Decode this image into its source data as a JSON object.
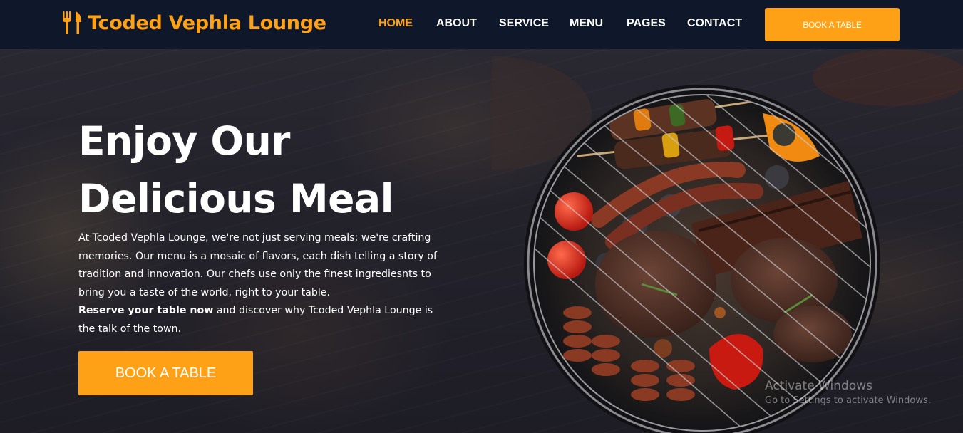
{
  "brand": {
    "name": "Tcoded Vephla Lounge",
    "icon": "utensils-icon",
    "accent_color": "#fea116",
    "navbar_color": "#0f172b"
  },
  "nav": {
    "links": [
      {
        "label": "HOME",
        "active": true
      },
      {
        "label": "ABOUT",
        "active": false
      },
      {
        "label": "SERVICE",
        "active": false
      },
      {
        "label": "MENU",
        "active": false
      },
      {
        "label": "PAGES",
        "active": false
      },
      {
        "label": "CONTACT",
        "active": false
      }
    ],
    "cta_label": "BOOK A TABLE"
  },
  "hero": {
    "title_line1": "Enjoy Our",
    "title_line2": "Delicious Meal",
    "paragraph": "At Tcoded Vephla Lounge, we're not just serving meals; we're crafting memories. Our menu is a mosaic of flavors, each dish telling a story of tradition and innovation. Our chefs use only the finest ingrediesnts to bring you a taste of the world, right to your table.",
    "reserve_bold": "Reserve your table now",
    "reserve_rest": " and discover why Tcoded Vephla Lounge is the talk of the town.",
    "cta_label": "BOOK A TABLE",
    "image": "grill-barbecue-image"
  },
  "watermark": {
    "title": "Activate Windows",
    "subtitle": "Go to Settings to activate Windows."
  }
}
